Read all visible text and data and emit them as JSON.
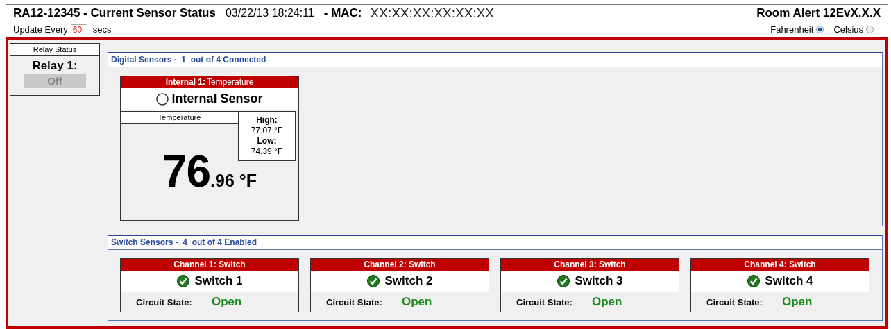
{
  "header": {
    "title": "RA12-12345 - Current Sensor Status",
    "timestamp": "03/22/13 18:24:11",
    "mac_label": "- MAC:",
    "mac": "XX:XX:XX:XX:XX:XX",
    "model": "Room Alert 12EvX.X.X"
  },
  "update": {
    "label": "Update Every",
    "value": "60",
    "unit": "secs"
  },
  "units": [
    {
      "label": "Fahrenheit",
      "selected": true
    },
    {
      "label": "Celsius",
      "selected": false
    }
  ],
  "relay": {
    "title": "Relay Status",
    "name": "Relay 1:",
    "state": "Off",
    "on": false
  },
  "digital": {
    "title": "Digital Sensors -  1  out of 4 Connected",
    "sensors": [
      {
        "label": "Internal 1:",
        "type": "Temperature",
        "name": "Internal Sensor",
        "reading_label": "Temperature",
        "high_label": "High:",
        "high": "77.07 °F",
        "low_label": "Low:",
        "low": "74.39 °F",
        "value_whole": "76",
        "value_fraction": ".96 °F"
      }
    ]
  },
  "switch_panel": {
    "title": "Switch Sensors -  4  out of 4 Enabled",
    "channels": [
      {
        "header": "Channel 1: Switch",
        "name": "Switch 1",
        "ok": true,
        "state_label": "Circuit State:",
        "state": "Open"
      },
      {
        "header": "Channel 2: Switch",
        "name": "Switch 2",
        "ok": true,
        "state_label": "Circuit State:",
        "state": "Open"
      },
      {
        "header": "Channel 3: Switch",
        "name": "Switch 3",
        "ok": true,
        "state_label": "Circuit State:",
        "state": "Open"
      },
      {
        "header": "Channel 4: Switch",
        "name": "Switch 4",
        "ok": true,
        "state_label": "Circuit State:",
        "state": "Open"
      }
    ]
  }
}
